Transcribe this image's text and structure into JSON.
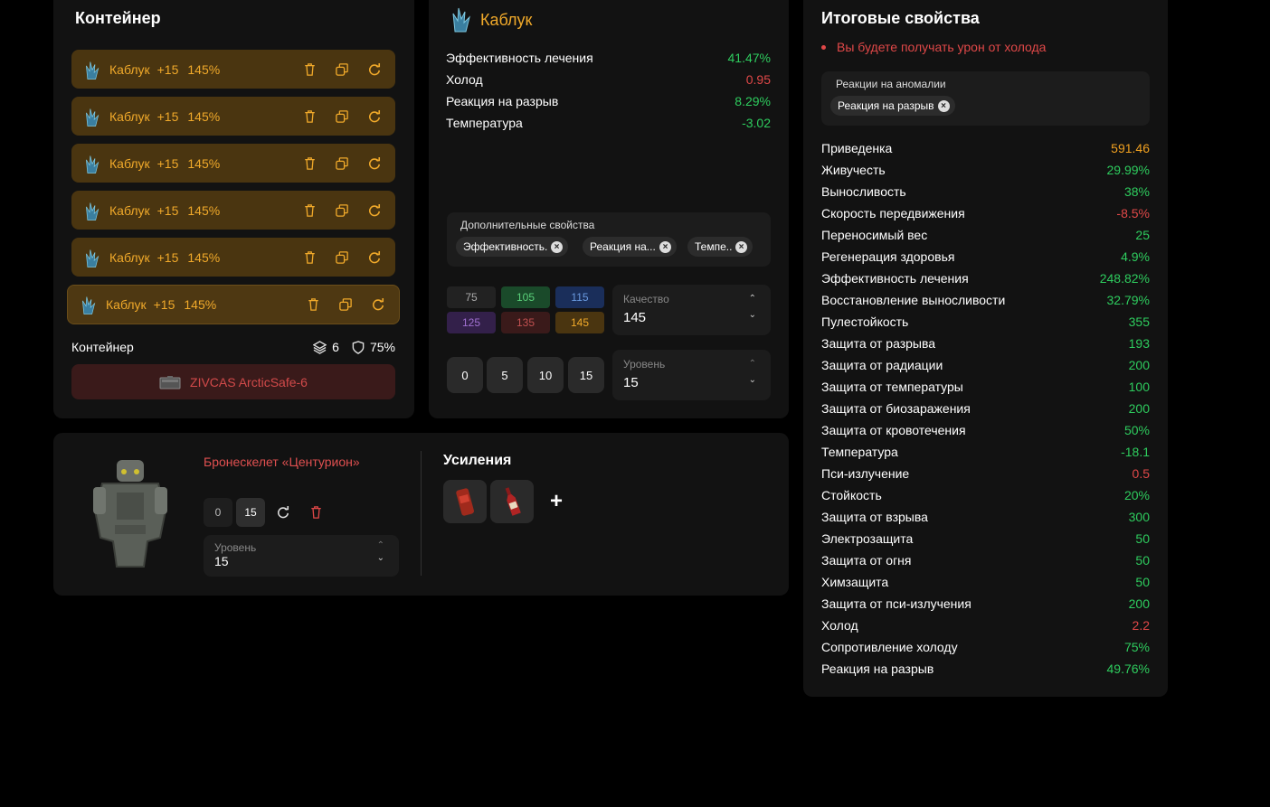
{
  "container": {
    "title": "Контейнер",
    "artifacts": [
      {
        "name": "Каблук",
        "plus": "+15",
        "percent": "145%"
      },
      {
        "name": "Каблук",
        "plus": "+15",
        "percent": "145%"
      },
      {
        "name": "Каблук",
        "plus": "+15",
        "percent": "145%"
      },
      {
        "name": "Каблук",
        "plus": "+15",
        "percent": "145%"
      },
      {
        "name": "Каблук",
        "plus": "+15",
        "percent": "145%"
      },
      {
        "name": "Каблук",
        "plus": "+15",
        "percent": "145%"
      }
    ],
    "footer_label": "Контейнер",
    "slots": "6",
    "protection": "75%",
    "container_name": "ZIVCAS ArcticSafe-6"
  },
  "artifact": {
    "title": "Каблук",
    "props": [
      {
        "name": "Эффективность лечения",
        "value": "41.47%",
        "color": "green"
      },
      {
        "name": "Холод",
        "value": "0.95",
        "color": "red"
      },
      {
        "name": "Реакция на разрыв",
        "value": "8.29%",
        "color": "green"
      },
      {
        "name": "Температура",
        "value": "-3.02",
        "color": "green"
      }
    ],
    "extra_label": "Дополнительные свойства",
    "extra_chips": [
      "Эффективность...",
      "Реакция на...",
      "Темпе..."
    ],
    "quality_buttons": [
      "75",
      "105",
      "115",
      "125",
      "135",
      "145"
    ],
    "quality_label": "Качество",
    "quality_value": "145",
    "level_buttons": [
      "0",
      "5",
      "10",
      "15"
    ],
    "level_label": "Уровень",
    "level_value": "15"
  },
  "armor": {
    "name": "Бронескелет «Центурион»",
    "level_min": "0",
    "level_current": "15",
    "level_label": "Уровень",
    "level_value": "15",
    "boosts_title": "Усиления"
  },
  "summary": {
    "title": "Итоговые свойства",
    "warning": "Вы будете получать урон от холода",
    "anomaly_label": "Реакции на аномалии",
    "anomaly_chip": "Реакция на разрыв",
    "rows": [
      {
        "name": "Приведенка",
        "value": "591.46",
        "color": "orange"
      },
      {
        "name": "Живучесть",
        "value": "29.99%",
        "color": "green"
      },
      {
        "name": "Выносливость",
        "value": "38%",
        "color": "green"
      },
      {
        "name": "Скорость передвижения",
        "value": "-8.5%",
        "color": "red"
      },
      {
        "name": "Переносимый вес",
        "value": "25",
        "color": "green"
      },
      {
        "name": "Регенерация здоровья",
        "value": "4.9%",
        "color": "green"
      },
      {
        "name": "Эффективность лечения",
        "value": "248.82%",
        "color": "green"
      },
      {
        "name": "Восстановление выносливости",
        "value": "32.79%",
        "color": "green"
      },
      {
        "name": "Пулестойкость",
        "value": "355",
        "color": "green"
      },
      {
        "name": "Защита от разрыва",
        "value": "193",
        "color": "green"
      },
      {
        "name": "Защита от радиации",
        "value": "200",
        "color": "green"
      },
      {
        "name": "Защита от температуры",
        "value": "100",
        "color": "green"
      },
      {
        "name": "Защита от биозаражения",
        "value": "200",
        "color": "green"
      },
      {
        "name": "Защита от кровотечения",
        "value": "50%",
        "color": "green"
      },
      {
        "name": "Температура",
        "value": "-18.1",
        "color": "green"
      },
      {
        "name": "Пси-излучение",
        "value": "0.5",
        "color": "red"
      },
      {
        "name": "Стойкость",
        "value": "20%",
        "color": "green"
      },
      {
        "name": "Защита от взрыва",
        "value": "300",
        "color": "green"
      },
      {
        "name": "Электрозащита",
        "value": "50",
        "color": "green"
      },
      {
        "name": "Защита от огня",
        "value": "50",
        "color": "green"
      },
      {
        "name": "Химзащита",
        "value": "50",
        "color": "green"
      },
      {
        "name": "Защита от пси-излучения",
        "value": "200",
        "color": "green"
      },
      {
        "name": "Холод",
        "value": "2.2",
        "color": "red"
      },
      {
        "name": "Сопротивление холоду",
        "value": "75%",
        "color": "green"
      },
      {
        "name": "Реакция на разрыв",
        "value": "49.76%",
        "color": "green"
      }
    ]
  }
}
